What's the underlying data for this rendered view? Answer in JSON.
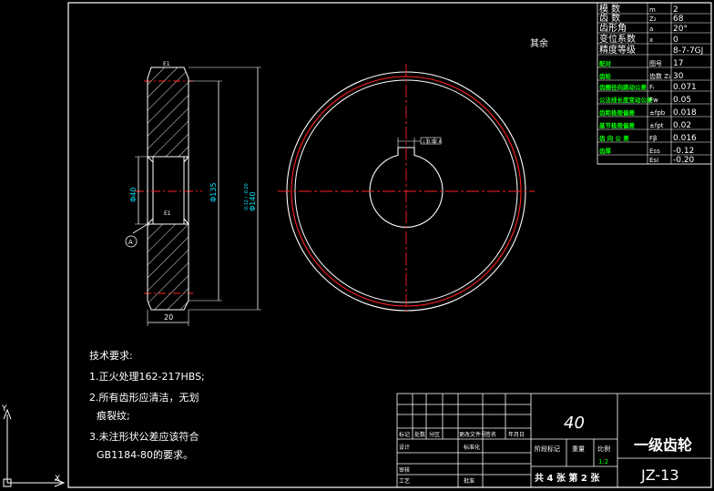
{
  "colors": {
    "background": "#000000",
    "outline": "#ffffff",
    "centerline": "#ff2020",
    "hatch": "#ffffff",
    "dimension": "#00e5ff",
    "table_accent": "#00ff00",
    "table_text": "#ffffff"
  },
  "drawing": {
    "note_qiyu": "其余",
    "section_label_top": "E1",
    "section_label_bottom": "E1",
    "dim_bore": "Φ40",
    "dim_hub": "Φ135",
    "dim_outer": "Φ140",
    "dim_outer_tol": "-0.12 / -0.20",
    "dim_width": "20",
    "datum_label": "A",
    "keyway_callout": "⊥ 0.02 A"
  },
  "gear_table": {
    "rows": [
      {
        "label": "模   数",
        "symbol": "m",
        "value": "2"
      },
      {
        "label": "齿   数",
        "symbol": "Z₂",
        "value": "68"
      },
      {
        "label": "齿形角",
        "symbol": "a",
        "value": "20°"
      },
      {
        "label": "变位系数",
        "symbol": "x",
        "value": "0"
      },
      {
        "label": "精度等级",
        "symbol": "",
        "value": "8-7-7GJ"
      },
      {
        "label": "配对",
        "symbol": "图号",
        "value": "17"
      },
      {
        "label": "齿轮",
        "symbol": "齿数 Z₁",
        "value": "30"
      },
      {
        "label": "齿圈径向跳动公差",
        "symbol": "Fᵣ",
        "value": "0.071"
      },
      {
        "label": "公法线长度变动公差",
        "symbol": "Fw",
        "value": "0.05"
      },
      {
        "label": "齿距极限偏差",
        "symbol": "±fpb",
        "value": "0.018"
      },
      {
        "label": "基节极限偏差",
        "symbol": "±fpt",
        "value": "0.02"
      },
      {
        "label": "齿 向 公 差",
        "symbol": "Fβ",
        "value": "0.016"
      },
      {
        "label": "齿厚",
        "symbol": "Ess",
        "value": "-0.12"
      },
      {
        "label": "",
        "symbol": "Esi",
        "value": "-0.20"
      }
    ]
  },
  "requirements": {
    "title": "技术要求:",
    "items": [
      "1.正火处理162-217HBS;",
      "2.所有齿形应清洁，无划",
      "痕裂纹;",
      "3.未注形状公差应该符合",
      "GB1184-80的要求。"
    ]
  },
  "title_block": {
    "material": "40",
    "part_name": "一级齿轮",
    "drawing_no": "JZ-13",
    "scale_label": "比例",
    "scale_value": "1:2",
    "weight_label": "重量",
    "stage_label": "阶段标记",
    "sheets": "共 4 张   第 2 张",
    "header_cells": [
      "标记",
      "处数",
      "分区",
      "更改文件号",
      "签名",
      "年月日"
    ],
    "design": "设计",
    "standardize": "标准化",
    "review": "审核",
    "process": "工艺",
    "approve": "批准"
  },
  "ucs": {
    "x": "X",
    "y": "Y"
  }
}
